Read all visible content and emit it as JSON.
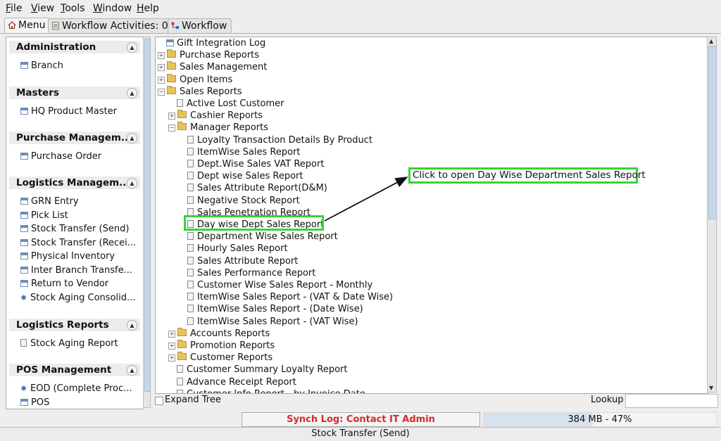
{
  "menubar": [
    "File",
    "View",
    "Tools",
    "Window",
    "Help"
  ],
  "tabs": [
    {
      "label": "Menu",
      "icon": "home-icon",
      "active": true
    },
    {
      "label": "Workflow Activities: 0",
      "icon": "clipboard-icon",
      "active": false
    },
    {
      "label": "Workflow",
      "icon": "workflow-icon",
      "active": false
    }
  ],
  "sidebar": {
    "groups": [
      {
        "title": "Administration",
        "items": [
          {
            "label": "Branch",
            "icon": "form-icon"
          }
        ]
      },
      {
        "title": "Masters",
        "items": [
          {
            "label": "HQ Product Master",
            "icon": "form-icon"
          }
        ]
      },
      {
        "title": "Purchase Managem...",
        "items": [
          {
            "label": "Purchase Order",
            "icon": "form-icon"
          }
        ]
      },
      {
        "title": "Logistics Managem...",
        "items": [
          {
            "label": "GRN Entry",
            "icon": "form-icon"
          },
          {
            "label": "Pick List",
            "icon": "form-icon"
          },
          {
            "label": "Stock Transfer (Send)",
            "icon": "form-icon"
          },
          {
            "label": "Stock Transfer (Recei...",
            "icon": "form-icon"
          },
          {
            "label": "Physical Inventory",
            "icon": "form-icon"
          },
          {
            "label": "Inter Branch Transfe...",
            "icon": "form-icon"
          },
          {
            "label": "Return to Vendor",
            "icon": "form-icon"
          },
          {
            "label": "Stock Aging Consolid...",
            "icon": "gear-icon"
          }
        ]
      },
      {
        "title": "Logistics Reports",
        "items": [
          {
            "label": "Stock Aging Report",
            "icon": "report-icon"
          }
        ]
      },
      {
        "title": "POS Management",
        "items": [
          {
            "label": "EOD (Complete Proc...",
            "icon": "gear-icon"
          },
          {
            "label": "POS",
            "icon": "form-icon"
          }
        ]
      }
    ]
  },
  "tree": [
    {
      "label": "Gift Integration Log",
      "level": 0,
      "kind": "form"
    },
    {
      "label": "Purchase Reports",
      "level": 0,
      "kind": "folder"
    },
    {
      "label": "Sales Management",
      "level": 0,
      "kind": "folder"
    },
    {
      "label": "Open Items",
      "level": 0,
      "kind": "folder"
    },
    {
      "label": "Sales Reports",
      "level": 0,
      "kind": "folder-open"
    },
    {
      "label": "Active Lost Customer",
      "level": 1,
      "kind": "report"
    },
    {
      "label": "Cashier Reports",
      "level": 1,
      "kind": "folder"
    },
    {
      "label": "Manager Reports",
      "level": 1,
      "kind": "folder-open"
    },
    {
      "label": "Loyalty Transaction Details By Product",
      "level": 2,
      "kind": "report"
    },
    {
      "label": "ItemWise Sales Report",
      "level": 2,
      "kind": "report"
    },
    {
      "label": "Dept.Wise Sales VAT Report",
      "level": 2,
      "kind": "report"
    },
    {
      "label": "Dept wise Sales Report",
      "level": 2,
      "kind": "report"
    },
    {
      "label": "Sales Attribute Report(D&M)",
      "level": 2,
      "kind": "report"
    },
    {
      "label": "Negative Stock Report",
      "level": 2,
      "kind": "report"
    },
    {
      "label": "Sales Penetration Report",
      "level": 2,
      "kind": "report"
    },
    {
      "label": "Day wise Dept Sales Report",
      "level": 2,
      "kind": "report"
    },
    {
      "label": "Department Wise Sales Report",
      "level": 2,
      "kind": "report"
    },
    {
      "label": "Hourly Sales Report",
      "level": 2,
      "kind": "report"
    },
    {
      "label": "Sales Attribute Report",
      "level": 2,
      "kind": "report"
    },
    {
      "label": "Sales Performance Report",
      "level": 2,
      "kind": "report"
    },
    {
      "label": "Customer Wise Sales Report - Monthly",
      "level": 2,
      "kind": "report"
    },
    {
      "label": "ItemWise Sales Report - (VAT & Date Wise)",
      "level": 2,
      "kind": "report"
    },
    {
      "label": "ItemWise Sales Report - (Date Wise)",
      "level": 2,
      "kind": "report"
    },
    {
      "label": "ItemWise Sales Report - (VAT Wise)",
      "level": 2,
      "kind": "report"
    },
    {
      "label": "Accounts Reports",
      "level": 1,
      "kind": "folder"
    },
    {
      "label": "Promotion Reports",
      "level": 1,
      "kind": "folder"
    },
    {
      "label": "Customer Reports",
      "level": 1,
      "kind": "folder"
    },
    {
      "label": "Customer Summary Loyalty Report",
      "level": 1,
      "kind": "report"
    },
    {
      "label": "Advance Receipt Report",
      "level": 1,
      "kind": "report"
    },
    {
      "label": "Customer Info Report - by Invoice Date",
      "level": 1,
      "kind": "report"
    }
  ],
  "annotation": {
    "callout": "Click to open Day Wise Department Sales Report",
    "highlight_color": "#39d239"
  },
  "bottom": {
    "expand_tree": "Expand Tree",
    "lookup": "Lookup"
  },
  "status": {
    "synch": "Synch Log: Contact IT Admin",
    "memory": "384 MB - 47%",
    "memory_fraction": 0.47,
    "synch_color": "#d42a2a"
  },
  "footer": "Stock Transfer (Send)"
}
